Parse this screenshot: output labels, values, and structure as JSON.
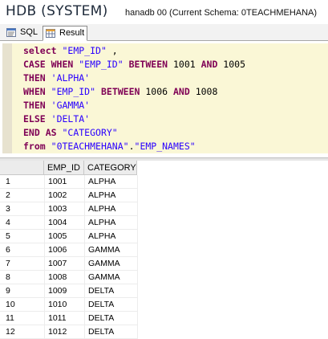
{
  "window": {
    "title": "HDB (SYSTEM)",
    "subtitle": "hanadb 00 (Current Schema: 0TEACHMEHANA)"
  },
  "tabs": [
    {
      "label": "SQL"
    },
    {
      "label": "Result"
    }
  ],
  "editor": {
    "lines": [
      {
        "tokens": [
          {
            "t": "select",
            "k": "kw"
          },
          {
            "t": " ",
            "k": "plain"
          },
          {
            "t": "\"EMP_ID\"",
            "k": "str"
          },
          {
            "t": " ,",
            "k": "plain"
          }
        ]
      },
      {
        "tokens": [
          {
            "t": "CASE WHEN",
            "k": "kw"
          },
          {
            "t": " ",
            "k": "plain"
          },
          {
            "t": "\"EMP_ID\"",
            "k": "str"
          },
          {
            "t": " ",
            "k": "plain"
          },
          {
            "t": "BETWEEN",
            "k": "kw"
          },
          {
            "t": " 1001 ",
            "k": "plain"
          },
          {
            "t": "AND",
            "k": "kw"
          },
          {
            "t": " 1005",
            "k": "plain"
          }
        ]
      },
      {
        "tokens": [
          {
            "t": "THEN",
            "k": "kw"
          },
          {
            "t": " ",
            "k": "plain"
          },
          {
            "t": "'ALPHA'",
            "k": "str"
          }
        ]
      },
      {
        "tokens": [
          {
            "t": "WHEN",
            "k": "kw"
          },
          {
            "t": " ",
            "k": "plain"
          },
          {
            "t": "\"EMP_ID\"",
            "k": "str"
          },
          {
            "t": " ",
            "k": "plain"
          },
          {
            "t": "BETWEEN",
            "k": "kw"
          },
          {
            "t": " 1006 ",
            "k": "plain"
          },
          {
            "t": "AND",
            "k": "kw"
          },
          {
            "t": " 1008",
            "k": "plain"
          }
        ]
      },
      {
        "tokens": [
          {
            "t": "THEN",
            "k": "kw"
          },
          {
            "t": " ",
            "k": "plain"
          },
          {
            "t": "'GAMMA'",
            "k": "str"
          }
        ]
      },
      {
        "tokens": [
          {
            "t": "ELSE",
            "k": "kw"
          },
          {
            "t": " ",
            "k": "plain"
          },
          {
            "t": "'DELTA'",
            "k": "str"
          }
        ]
      },
      {
        "tokens": [
          {
            "t": "END AS",
            "k": "kw"
          },
          {
            "t": " ",
            "k": "plain"
          },
          {
            "t": "\"CATEGORY\"",
            "k": "str"
          }
        ]
      },
      {
        "tokens": [
          {
            "t": "from",
            "k": "kw"
          },
          {
            "t": " ",
            "k": "plain"
          },
          {
            "t": "\"0TEACHMEHANA\"",
            "k": "str"
          },
          {
            "t": ".",
            "k": "plain"
          },
          {
            "t": "\"EMP_NAMES\"",
            "k": "str"
          }
        ]
      }
    ]
  },
  "results": {
    "columns": [
      "",
      "EMP_ID",
      "CATEGORY"
    ],
    "rows": [
      [
        "1",
        "1001",
        "ALPHA"
      ],
      [
        "2",
        "1002",
        "ALPHA"
      ],
      [
        "3",
        "1003",
        "ALPHA"
      ],
      [
        "4",
        "1004",
        "ALPHA"
      ],
      [
        "5",
        "1005",
        "ALPHA"
      ],
      [
        "6",
        "1006",
        "GAMMA"
      ],
      [
        "7",
        "1007",
        "GAMMA"
      ],
      [
        "8",
        "1008",
        "GAMMA"
      ],
      [
        "9",
        "1009",
        "DELTA"
      ],
      [
        "10",
        "1010",
        "DELTA"
      ],
      [
        "11",
        "1011",
        "DELTA"
      ],
      [
        "12",
        "1012",
        "DELTA"
      ]
    ]
  },
  "icons": {
    "sql_tab": "sql-icon",
    "result_tab": "result-grid-icon"
  },
  "colors": {
    "keyword": "#7f0055",
    "string": "#2a00ff",
    "editor_background": "#faf7d6"
  }
}
